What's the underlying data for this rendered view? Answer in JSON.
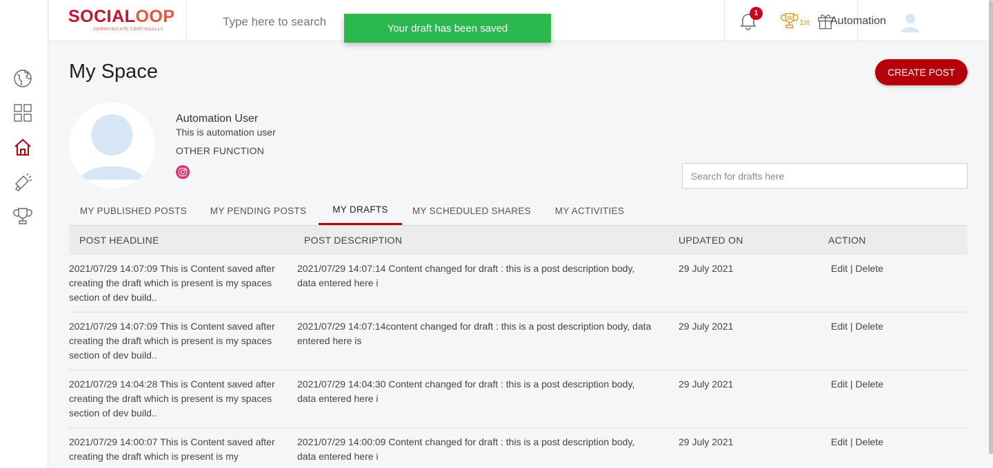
{
  "brand": {
    "logo_text_a": "SOCIAL",
    "logo_text_b": "OOP",
    "tagline": "COMMUNICATE CONTINUALLY",
    "color": "#c8102e"
  },
  "topbar": {
    "search_placeholder": "Type here to search",
    "toast": "Your draft has been saved",
    "notification_count": "1",
    "rank": "1st",
    "user_name": "Automation"
  },
  "nav": {
    "items": [
      {
        "icon": "globe-icon"
      },
      {
        "icon": "grid-icon"
      },
      {
        "icon": "home-icon",
        "active": true
      },
      {
        "icon": "megaphone-icon"
      },
      {
        "icon": "trophy-icon"
      }
    ]
  },
  "page": {
    "title": "My Space",
    "create_button": "CREATE POST"
  },
  "profile": {
    "name": "Automation User",
    "bio": "This is automation user",
    "function": "OTHER FUNCTION"
  },
  "drafts_search": {
    "placeholder": "Search for drafts here"
  },
  "tabs": [
    {
      "label": "MY PUBLISHED POSTS"
    },
    {
      "label": "MY PENDING POSTS"
    },
    {
      "label": "MY DRAFTS",
      "active": true
    },
    {
      "label": "MY SCHEDULED SHARES"
    },
    {
      "label": "MY ACTIVITIES"
    }
  ],
  "table": {
    "headers": {
      "headline": "POST HEADLINE",
      "description": "POST DESCRIPTION",
      "updated": "UPDATED ON",
      "action": "ACTION"
    },
    "rows": [
      {
        "headline": "2021/07/29 14:07:09 This is Content saved after creating the draft which is present is my spaces section of dev build..",
        "description": "2021/07/29 14:07:14 Content changed for draft : this is a post description body, data entered here i",
        "updated": "29 July 2021",
        "edit": "Edit",
        "sep": " | ",
        "delete": "Delete"
      },
      {
        "headline": "2021/07/29 14:07:09 This is Content saved after creating the draft which is present is my spaces section of dev build..",
        "description": "2021/07/29 14:07:14content changed for draft : this is a post description body, data entered here is",
        "updated": "29 July 2021",
        "edit": "Edit",
        "sep": " | ",
        "delete": "Delete"
      },
      {
        "headline": "2021/07/29 14:04:28 This is Content saved after creating the draft which is present is my spaces section of dev build..",
        "description": "2021/07/29 14:04:30 Content changed for draft : this is a post description body, data entered here i",
        "updated": "29 July 2021",
        "edit": "Edit",
        "sep": " | ",
        "delete": "Delete"
      },
      {
        "headline": "2021/07/29 14:00:07 This is Content saved after creating the draft which is present is my",
        "description": "2021/07/29 14:00:09 Content changed for draft : this is a post description body, data entered here i",
        "updated": "29 July 2021",
        "edit": "Edit",
        "sep": " | ",
        "delete": "Delete"
      }
    ]
  }
}
